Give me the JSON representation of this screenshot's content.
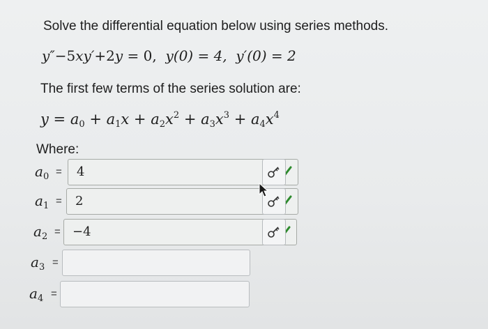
{
  "problem": {
    "prompt": "Solve the differential equation below using series methods.",
    "equation": {
      "lhs_y2": "y″",
      "minus": "−5",
      "xy1": "xy′",
      "plus2y": "+2",
      "y": "y",
      "eq0": " = 0,",
      "ic1": "y(0) = 4,",
      "ic2": "y′(0) = 2"
    },
    "series_intro": "The first few terms of the series solution are:",
    "series": {
      "y": "y",
      "eq": " = ",
      "a0": "a",
      "a0s": "0",
      "p1": " + ",
      "a1": "a",
      "a1s": "1",
      "x1": "x",
      "p2": " + ",
      "a2": "a",
      "a2s": "2",
      "x2": "x",
      "e2": "2",
      "p3": " + ",
      "a3": "a",
      "a3s": "3",
      "x3": "x",
      "e3": "3",
      "p4": " + ",
      "a4": "a",
      "a4s": "4",
      "x4": "x",
      "e4": "4"
    },
    "where_label": "Where:"
  },
  "answers": [
    {
      "var": "a",
      "sub": "0",
      "value": "4",
      "status": "correct"
    },
    {
      "var": "a",
      "sub": "1",
      "value": "2",
      "status": "correct"
    },
    {
      "var": "a",
      "sub": "2",
      "value": "−4",
      "status": "correct"
    },
    {
      "var": "a",
      "sub": "3",
      "value": "",
      "status": "empty"
    },
    {
      "var": "a",
      "sub": "4",
      "value": "",
      "status": "empty"
    }
  ],
  "eq_symbol": "=",
  "colors": {
    "check": "#2d8a2d",
    "background": "#eceeef"
  },
  "icons": {
    "correct": "checkmark-icon",
    "key": "key-icon"
  }
}
